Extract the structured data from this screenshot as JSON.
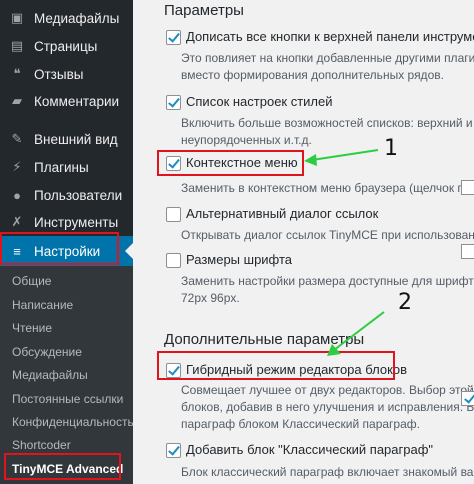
{
  "sidebar": {
    "items": [
      {
        "label": "Медиафайлы",
        "icon": "media-icon"
      },
      {
        "label": "Страницы",
        "icon": "pages-icon"
      },
      {
        "label": "Отзывы",
        "icon": "feedback-icon"
      },
      {
        "label": "Комментарии",
        "icon": "comments-icon"
      },
      {
        "label": "Внешний вид",
        "icon": "appearance-icon"
      },
      {
        "label": "Плагины",
        "icon": "plugins-icon"
      },
      {
        "label": "Пользователи",
        "icon": "users-icon"
      },
      {
        "label": "Инструменты",
        "icon": "tools-icon"
      },
      {
        "label": "Настройки",
        "icon": "settings-icon"
      }
    ],
    "submenu": [
      "Общие",
      "Написание",
      "Чтение",
      "Обсуждение",
      "Медиафайлы",
      "Постоянные ссылки",
      "Конфиденциальность",
      "Shortcoder",
      "TinyMCE Advanced"
    ]
  },
  "content": {
    "section1_title": "Параметры",
    "opt1": {
      "label": "Дописать все кнопки к верхней панели инструментов в это",
      "desc1": "Это повлияет на кнопки добавленные другими плагинами.",
      "desc2": "вместо формирования дополнительных рядов.",
      "checked": true
    },
    "opt2": {
      "label": "Список настроек стилей",
      "desc1": "Включить больше возможностей списков: верхний и нижн",
      "desc2": "неупорядоченных и.т.д.",
      "checked": true
    },
    "opt3": {
      "label": "Контекстное меню",
      "desc1": "Заменить в контекстном меню браузера (щелчок правой",
      "checked": true
    },
    "opt4": {
      "label": "Альтернативный диалог ссылок",
      "desc1": "Открывать диалог ссылок TinyMCE при использовании г",
      "checked": false
    },
    "opt5": {
      "label": "Размеры шрифта",
      "desc1": "Заменить настройки размера доступные для шрифтов на:",
      "desc2": "72px 96px.",
      "checked": false
    },
    "section2_title": "Дополнительные параметры",
    "opt6": {
      "label": "Гибридный режим редактора блоков",
      "desc1": "Совмещает лучшее от двух редакторов. Выбор этой опц",
      "desc2": "блоков, добавив в него улучшения и исправления. Блок",
      "desc3": "параграф блоком Классический параграф.",
      "checked": true
    },
    "opt7": {
      "label": "Добавить блок \"Классический параграф\"",
      "desc1": "Блок классический параграф включает знакомый вам ре",
      "checked": true
    }
  },
  "annotations": {
    "n1": "1",
    "n2": "2"
  },
  "colors": {
    "highlight": "#e0141e",
    "arrow": "#2ecc40",
    "accent": "#0073aa"
  }
}
